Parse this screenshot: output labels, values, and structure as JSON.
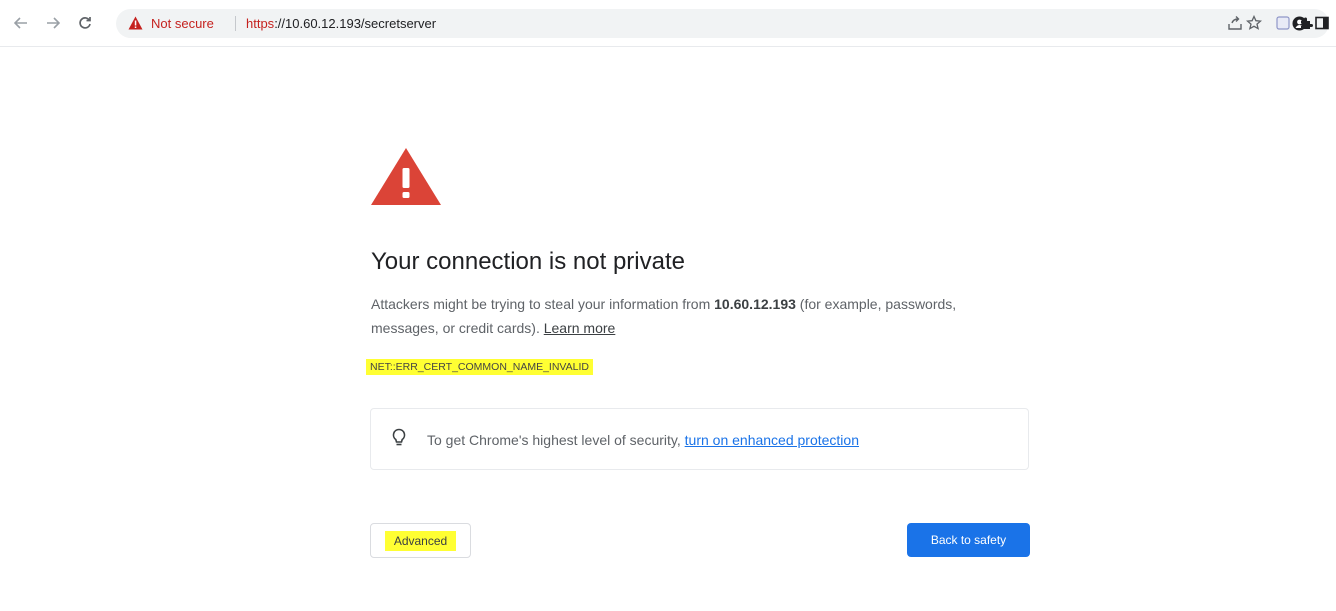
{
  "toolbar": {
    "back_icon": "arrow-left-icon",
    "forward_icon": "arrow-right-icon",
    "reload_icon": "reload-icon",
    "right_icons": [
      "share-icon",
      "star-icon",
      "extension-square-icon",
      "profile-icon",
      "puzzle-icon",
      "side-panel-icon"
    ]
  },
  "omnibox": {
    "security_status": "Not secure",
    "url_scheme": "https",
    "url_rest": "://10.60.12.193/secretserver"
  },
  "interstitial": {
    "heading": "Your connection is not private",
    "desc_before": "Attackers might be trying to steal your information from ",
    "desc_host": "10.60.12.193",
    "desc_after": " (for example, passwords, messages, or credit cards). ",
    "learn_more": "Learn more",
    "error_code": "NET::ERR_CERT_COMMON_NAME_INVALID",
    "enhanced_text": "To get Chrome's highest level of security, ",
    "enhanced_link": "turn on enhanced protection",
    "advanced_label": "Advanced",
    "back_label": "Back to safety"
  },
  "colors": {
    "warning_red": "#db4437",
    "link_blue": "#1a73e8",
    "highlight_yellow": "#ffff33"
  }
}
